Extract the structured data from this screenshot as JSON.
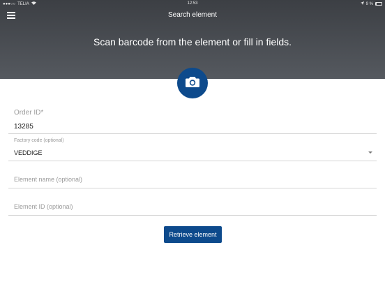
{
  "status_bar": {
    "carrier": "TELIA",
    "time": "12:53",
    "battery": "9 %"
  },
  "nav": {
    "title": "Search element"
  },
  "header": {
    "instruction": "Scan barcode from the element or fill in fields."
  },
  "form": {
    "order_id": {
      "label": "Order ID*",
      "value": "13285"
    },
    "factory_code": {
      "label": "Factory code (optional)",
      "value": "VEDDIGE"
    },
    "element_name": {
      "placeholder": "Element name (optional)"
    },
    "element_id": {
      "placeholder": "Element ID (optional)"
    },
    "retrieve_label": "Retrieve element"
  },
  "colors": {
    "accent": "#0d4a8c",
    "header_bg": "#45484d"
  },
  "icons": {
    "menu": "hamburger-icon",
    "camera": "camera-icon",
    "dropdown": "chevron-down-icon"
  }
}
